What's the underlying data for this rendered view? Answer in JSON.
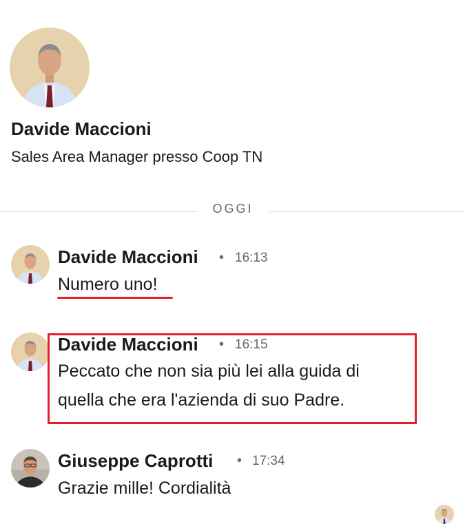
{
  "profile": {
    "name": "Davide Maccioni",
    "headline": "Sales Area Manager presso Coop TN"
  },
  "divider": {
    "label": "OGGI"
  },
  "messages": [
    {
      "sender": "Davide Maccioni",
      "separator": "•",
      "time": "16:13",
      "lines": [
        "Numero uno!"
      ]
    },
    {
      "sender": "Davide Maccioni",
      "separator": "•",
      "time": "16:15",
      "lines": [
        "Peccato che non sia più lei alla guida di",
        "quella che era l'azienda di suo Padre."
      ]
    },
    {
      "sender": "Giuseppe Caprotti",
      "separator": "•",
      "time": "17:34",
      "lines": [
        "Grazie mille! Cordialità"
      ]
    }
  ],
  "annotations": {
    "color": "#e3202a"
  },
  "colors": {
    "text": "#1a1a1a",
    "muted": "#666666",
    "divider": "#d9d9d9"
  }
}
